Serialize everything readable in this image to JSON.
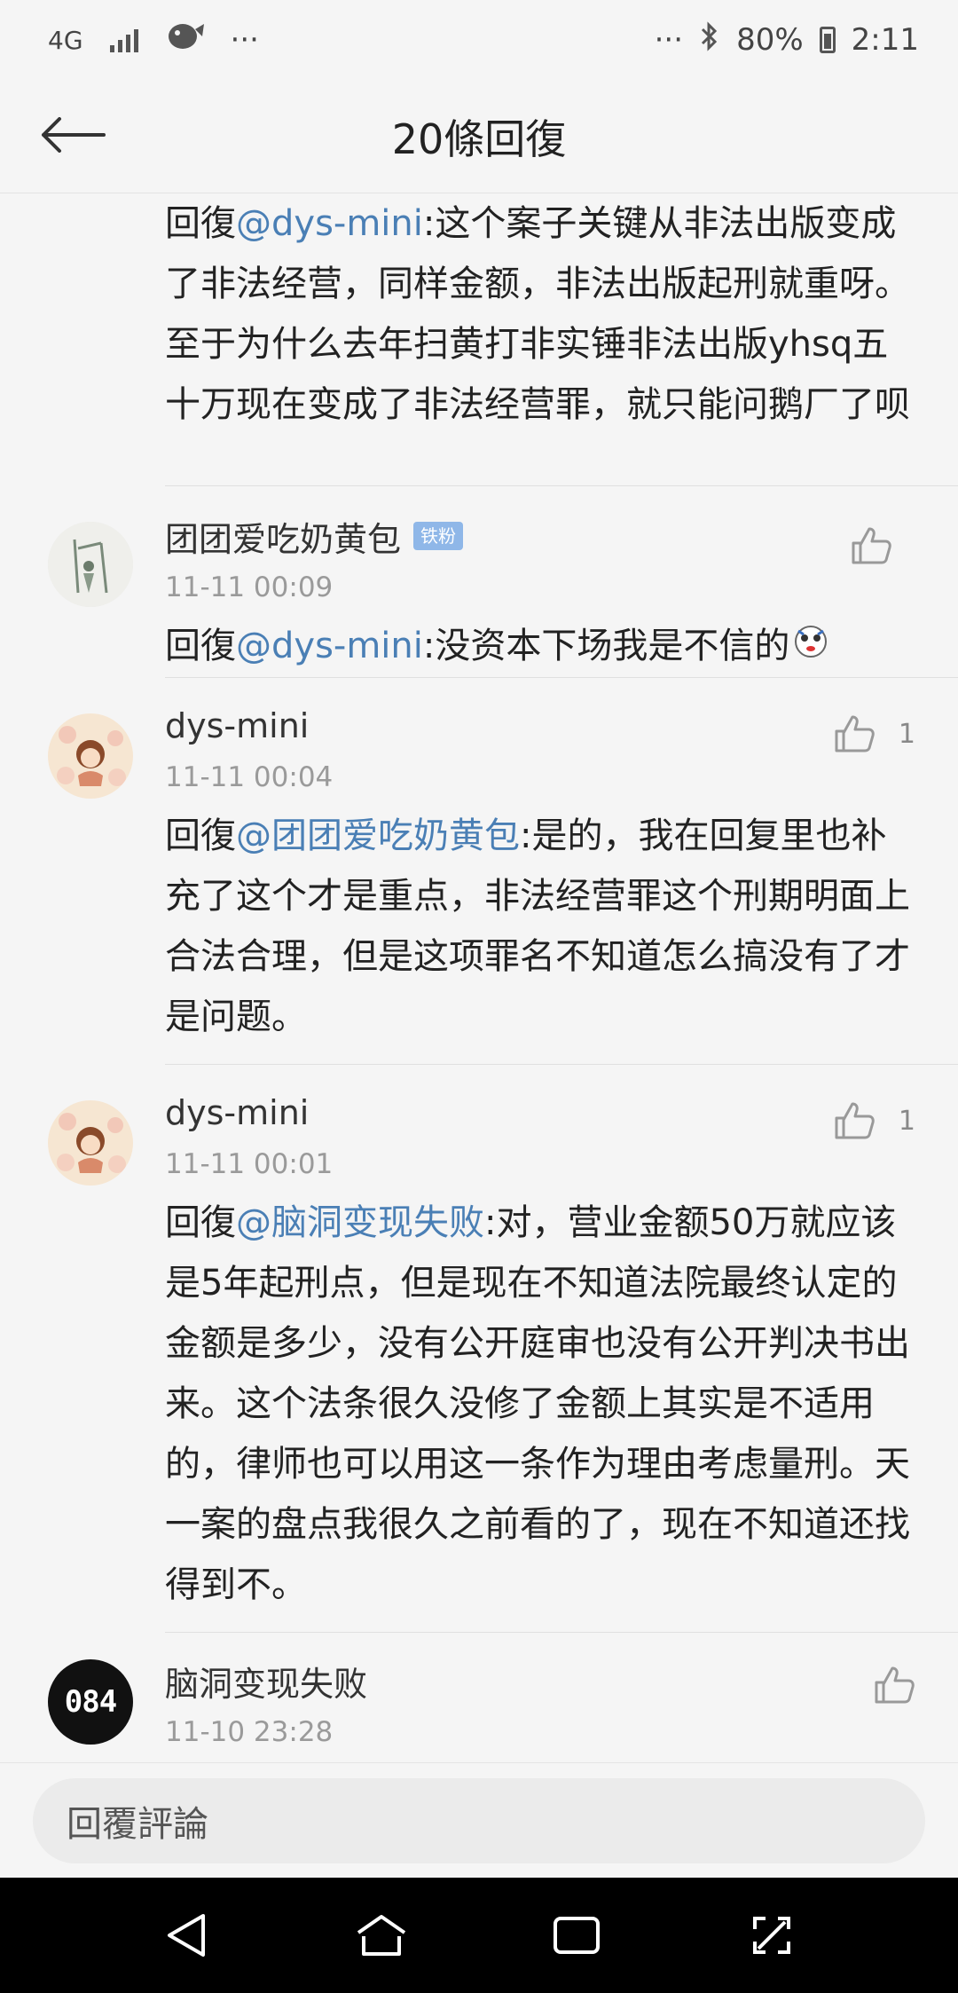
{
  "status_bar": {
    "network": "4G",
    "extra_dots_left": "···",
    "extra_dots_right": "···",
    "battery": "80%",
    "time": "2:11"
  },
  "header": {
    "title": "20條回復"
  },
  "comments": [
    {
      "prefix": "回復",
      "mention": "@dys-mini",
      "text": ":这个案子关键从非法出版变成了非法经营，同样金额，非法出版起刑就重呀。至于为什么去年扫黄打非实锤非法出版yhsq五十万现在变成了非法经营罪，就只能问鹅厂了呗"
    },
    {
      "author": "团团爱吃奶黄包",
      "badge": "铁粉",
      "time": "11-11 00:09",
      "prefix": "回復",
      "mention": "@dys-mini",
      "text": ":没资本下场我是不信的",
      "likes": ""
    },
    {
      "author": "dys-mini",
      "time": "11-11 00:04",
      "prefix": "回復",
      "mention": "@团团爱吃奶黄包",
      "text": ":是的，我在回复里也补充了这个才是重点，非法经营罪这个刑期明面上合法合理，但是这项罪名不知道怎么搞没有了才是问题。",
      "likes": "1"
    },
    {
      "author": "dys-mini",
      "time": "11-11 00:01",
      "prefix": "回復",
      "mention": "@脑洞变现失败",
      "text": ":对，营业金额50万就应该是5年起刑点，但是现在不知道法院最终认定的金额是多少，没有公开庭审也没有公开判决书出来。这个法条很久没修了金额上其实是不适用的，律师也可以用这一条作为理由考虑量刑。天一案的盘点我很久之前看的了，现在不知道还找得到不。",
      "likes": "1"
    },
    {
      "author": "脑洞变现失败",
      "time": "11-10 23:28",
      "avatar_text": "084"
    }
  ],
  "bottom": {
    "reply_placeholder": "回覆評論"
  },
  "colors": {
    "mention": "#4a7fb5",
    "badge": "#8fb7e8",
    "background": "#f5f5f5"
  }
}
